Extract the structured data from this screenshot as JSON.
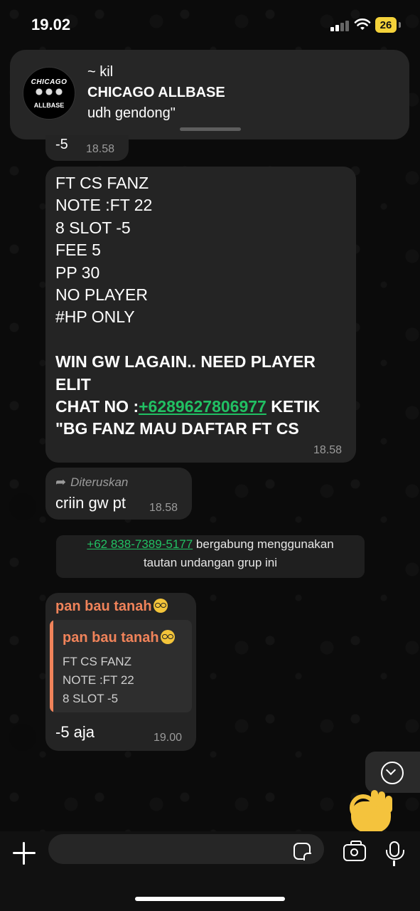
{
  "status_bar": {
    "time": "19.02",
    "battery": "26"
  },
  "notification": {
    "sender": "~ kil",
    "group": "CHICAGO ALLBASE",
    "text": "udh gendong\"",
    "avatar_text_top": "CHICAGO",
    "avatar_text_bottom": "ALLBASE"
  },
  "messages": [
    {
      "text": "-5",
      "time": "18.58"
    },
    {
      "lines": [
        "FT CS FANZ",
        "NOTE :FT 22",
        "8 SLOT -5",
        "FEE 5",
        "PP 30",
        "NO PLAYER",
        "#HP ONLY",
        ""
      ],
      "bold_lines": [
        "WIN GW LAGAIN.. NEED PLAYER",
        "ELIT"
      ],
      "chat_prefix": "CHAT NO :",
      "phone_link": "+6289627806977",
      "chat_suffix": " KETIK",
      "last_line": "\"BG FANZ MAU DAFTAR FT CS",
      "time": "18.58"
    },
    {
      "forwarded_label": "Diteruskan",
      "text": "criin gw pt",
      "time": "18.58"
    },
    {
      "sender": "pan bau tanah",
      "quote": {
        "sender": "pan bau tanah",
        "lines": [
          "FT CS FANZ",
          "NOTE :FT 22",
          "8 SLOT -5"
        ]
      },
      "text": "-5 aja",
      "time": "19.00"
    }
  ],
  "system_message": {
    "phone": "+62 838-7389-5177",
    "text_after_phone": " bergabung menggunakan",
    "line2": "tautan undangan grup ini"
  },
  "input": {
    "placeholder": ""
  },
  "colors": {
    "link": "#21c063",
    "sender_name": "#f0835a",
    "bubble": "#242424",
    "battery": "#f4d23a"
  },
  "icons": [
    "signal-icon",
    "wifi-icon",
    "battery-icon",
    "forward-icon",
    "nerd-face-emoji",
    "chevron-down-icon",
    "ok-hand-emoji",
    "plus-icon",
    "sticker-icon",
    "camera-icon",
    "mic-icon"
  ]
}
